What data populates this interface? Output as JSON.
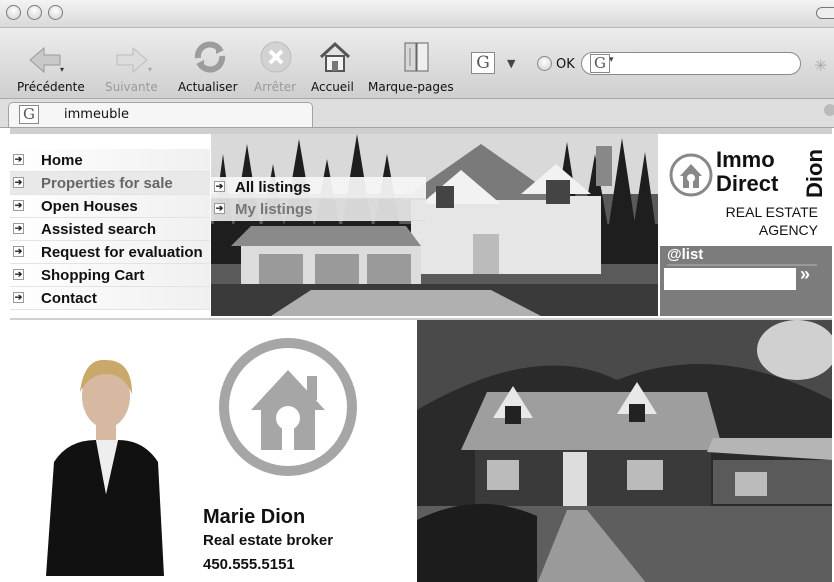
{
  "toolbar": {
    "back_label": "Précédente",
    "forward_label": "Suivante",
    "reload_label": "Actualiser",
    "stop_label": "Arrêter",
    "home_label": "Accueil",
    "bookmarks_label": "Marque-pages",
    "search_engine_glyph": "G",
    "ok_label": "OK",
    "url_glyph": "G"
  },
  "tab": {
    "glyph": "G",
    "title": "immeuble"
  },
  "nav": {
    "items": [
      {
        "label": "Home"
      },
      {
        "label": "Properties for sale"
      },
      {
        "label": "Open Houses"
      },
      {
        "label": "Assisted search"
      },
      {
        "label": "Request for evaluation"
      },
      {
        "label": "Shopping Cart"
      },
      {
        "label": "Contact"
      }
    ]
  },
  "submenu": {
    "items": [
      {
        "label": "All listings"
      },
      {
        "label": "My listings"
      }
    ]
  },
  "brand": {
    "line1": "Immo",
    "line2": "Direct",
    "vertical": "Dion",
    "tag1": "REAL ESTATE",
    "tag2": "AGENCY",
    "list_label": "@list",
    "go_label": "»"
  },
  "agent": {
    "name": "Marie Dion",
    "role": "Real estate broker",
    "phone": "450.555.5151"
  },
  "colors": {
    "logo_gray": "#a6a6a6",
    "panel_gray": "#7c7c7c"
  }
}
